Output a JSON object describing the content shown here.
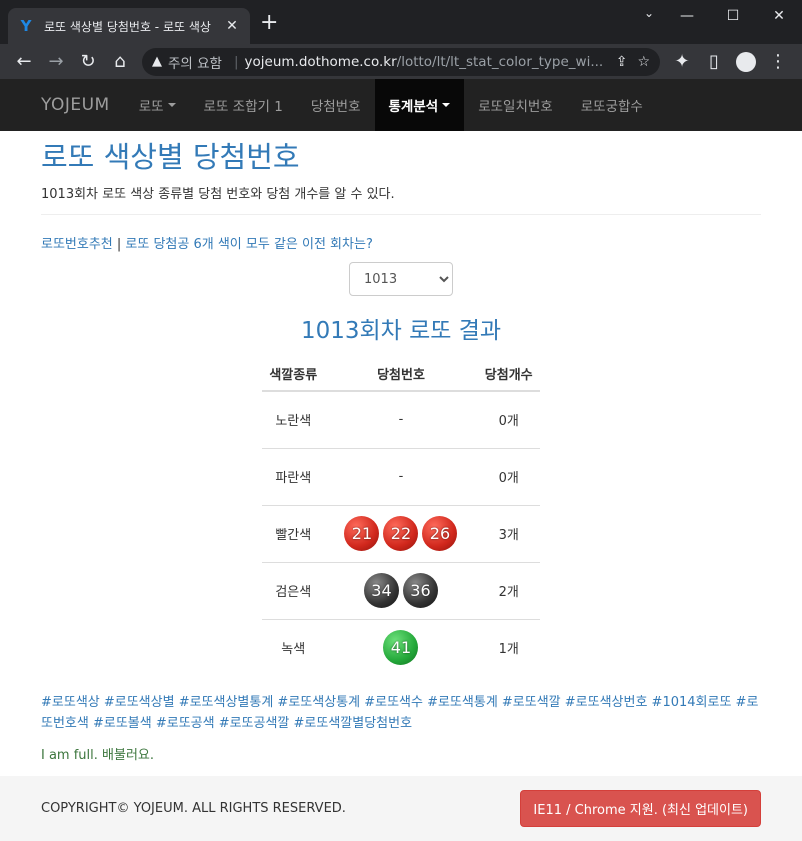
{
  "browser": {
    "tab_title": "로또 색상별 당첨번호 - 로또 색상",
    "address_security": "주의 요함",
    "address_host": "yojeum.dothome.co.kr",
    "address_path": "/lotto/lt/lt_stat_color_type_wi...",
    "new_tab": "+"
  },
  "navbar": {
    "brand": "YOJEUM",
    "items": [
      {
        "label": "로또"
      },
      {
        "label": "로또 조합기 1"
      },
      {
        "label": "당첨번호"
      },
      {
        "label": "통계분석"
      },
      {
        "label": "로또일치번호"
      },
      {
        "label": "로또궁합수"
      }
    ]
  },
  "page": {
    "title": "로또 색상별 당첨번호",
    "lead": "1013회차 로또 색상 종류별 당첨 번호와 당첨 개수를 알 수 있다.",
    "link1": "로또번호추천",
    "link_sep": " | ",
    "link2": "로또 당첨공 6개 색이 모두 같은 이전 회차는?",
    "select_value": "1013",
    "result_title": "1013회차 로또 결과",
    "table": {
      "headers": [
        "색깔종류",
        "당첨번호",
        "당첨개수"
      ],
      "rows": [
        {
          "color": "노란색",
          "numbers": "-",
          "count": "0개"
        },
        {
          "color": "파란색",
          "numbers": "-",
          "count": "0개"
        },
        {
          "color": "빨간색",
          "balls": [
            "21",
            "22",
            "26"
          ],
          "count": "3개"
        },
        {
          "color": "검은색",
          "balls": [
            "34",
            "36"
          ],
          "count": "2개"
        },
        {
          "color": "녹색",
          "balls": [
            "41"
          ],
          "count": "1개"
        }
      ]
    },
    "tags": "#로또색상 #로또색상별 #로또색상별통계 #로또색상통계 #로또색수 #로또색통계 #로또색깔 #로또색상번호 #1014회로또 #로또번호색 #로또볼색 #로또공색 #로또공색깔 #로또색깔별당첨번호",
    "full": "I am full. 배불러요."
  },
  "footer": {
    "copyright": "COPYRIGHT© YOJEUM. ALL RIGHTS RESERVED.",
    "button": "IE11 / Chrome 지원. (최신 업데이트)"
  },
  "colors": {
    "link": "#337ab7",
    "navbar_bg": "#222222",
    "ball_red": "#d0271c",
    "ball_black": "#333333",
    "ball_green": "#24a83a",
    "footer_button": "#d9534f"
  }
}
